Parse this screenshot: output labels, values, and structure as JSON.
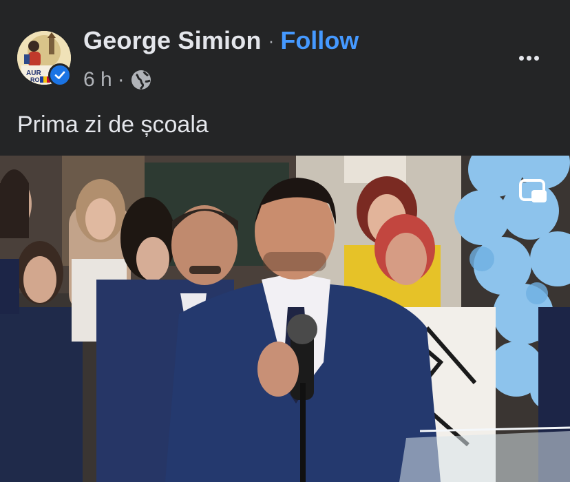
{
  "post": {
    "author": "George Simion",
    "separator": "·",
    "follow_label": "Follow",
    "time": "6 h",
    "meta_separator": "·",
    "audience_icon": "globe-icon",
    "verified_icon": "verified-badge-icon",
    "text": "Prima zi de școala",
    "more_icon": "more-options-icon"
  },
  "avatar": {
    "logo_text": "AUR",
    "logo_text_2": "RO"
  },
  "media": {
    "type": "video",
    "pip_icon": "picture-in-picture-icon"
  },
  "colors": {
    "background": "#242526",
    "text_primary": "#e4e6eb",
    "text_secondary": "#b0b3b8",
    "link": "#4599ff",
    "verified": "#1b74e4"
  }
}
